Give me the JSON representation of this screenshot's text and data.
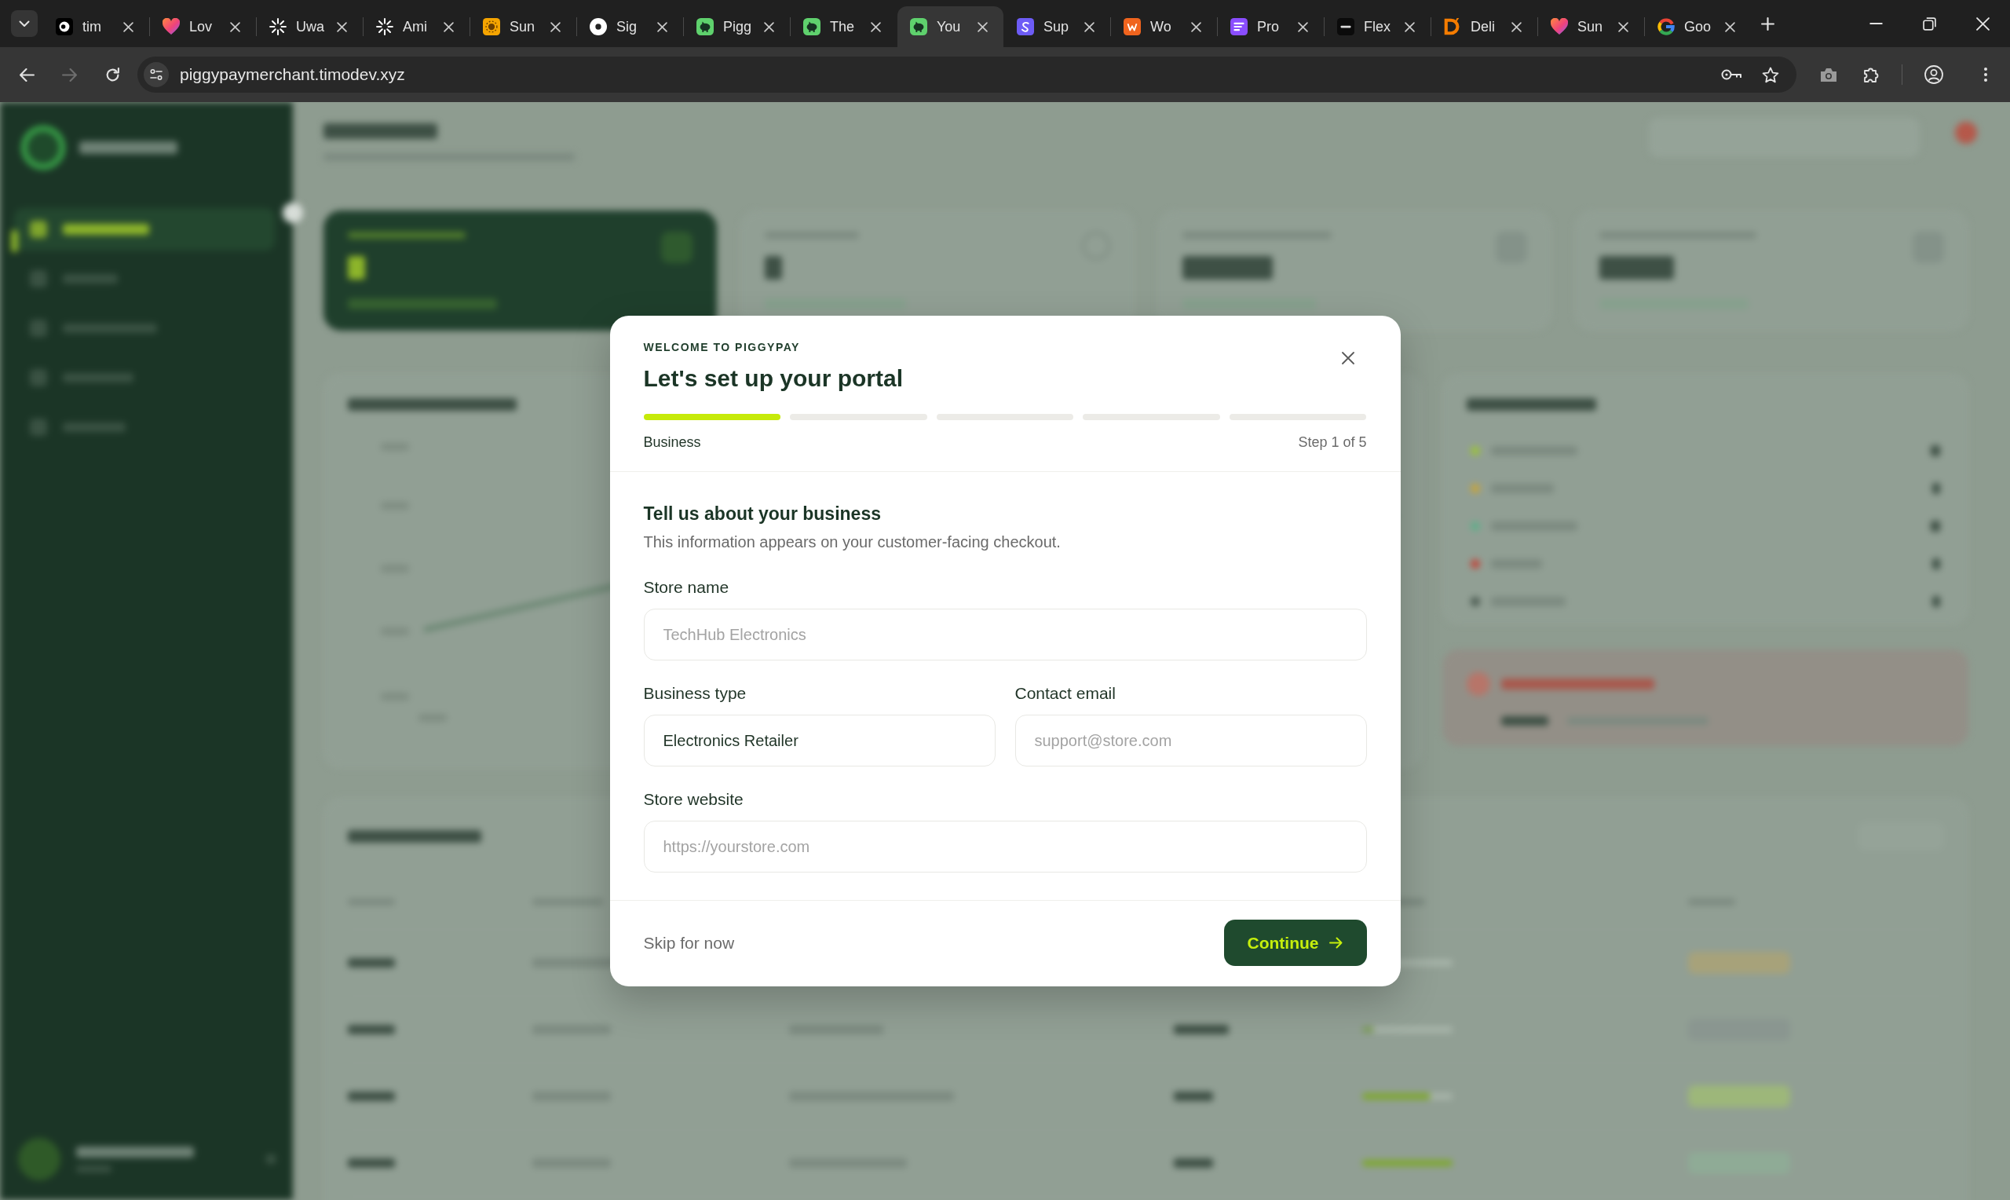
{
  "browser": {
    "tabs": [
      {
        "title": "tim",
        "selected": false
      },
      {
        "title": "Lov",
        "selected": false
      },
      {
        "title": "Uwa",
        "selected": false
      },
      {
        "title": "Ami",
        "selected": false
      },
      {
        "title": "Sun",
        "selected": false
      },
      {
        "title": "Sig",
        "selected": false
      },
      {
        "title": "Pigg",
        "selected": false
      },
      {
        "title": "The",
        "selected": false
      },
      {
        "title": "You",
        "selected": true
      },
      {
        "title": "Sup",
        "selected": false
      },
      {
        "title": "Wo",
        "selected": false
      },
      {
        "title": "Pro",
        "selected": false
      },
      {
        "title": "Flex",
        "selected": false
      },
      {
        "title": "Deli",
        "selected": false
      },
      {
        "title": "Sun",
        "selected": false
      },
      {
        "title": "Goo",
        "selected": false
      }
    ],
    "address": "piggypaymerchant.timodev.xyz",
    "forward_disabled": true
  },
  "modal": {
    "eyebrow": "WELCOME TO PIGGYPAY",
    "title": "Let's set up your portal",
    "progress": [
      {
        "filled": true
      },
      {
        "filled": false
      },
      {
        "filled": false
      },
      {
        "filled": false
      },
      {
        "filled": false
      }
    ],
    "step_name": "Business",
    "step_count": "Step 1 of 5",
    "section_title": "Tell us about your business",
    "section_subtitle": "This information appears on your customer-facing checkout.",
    "field_rows": [
      [
        {
          "label": "Store name",
          "placeholder": "TechHub Electronics"
        }
      ],
      [
        {
          "label": "Business type",
          "value": "Electronics Retailer"
        },
        {
          "label": "Contact email",
          "placeholder": "support@store.com"
        }
      ],
      [
        {
          "label": "Store website",
          "placeholder": "https://yourstore.com"
        }
      ]
    ],
    "skip_link": "Skip for now",
    "continue_button": "Continue"
  }
}
